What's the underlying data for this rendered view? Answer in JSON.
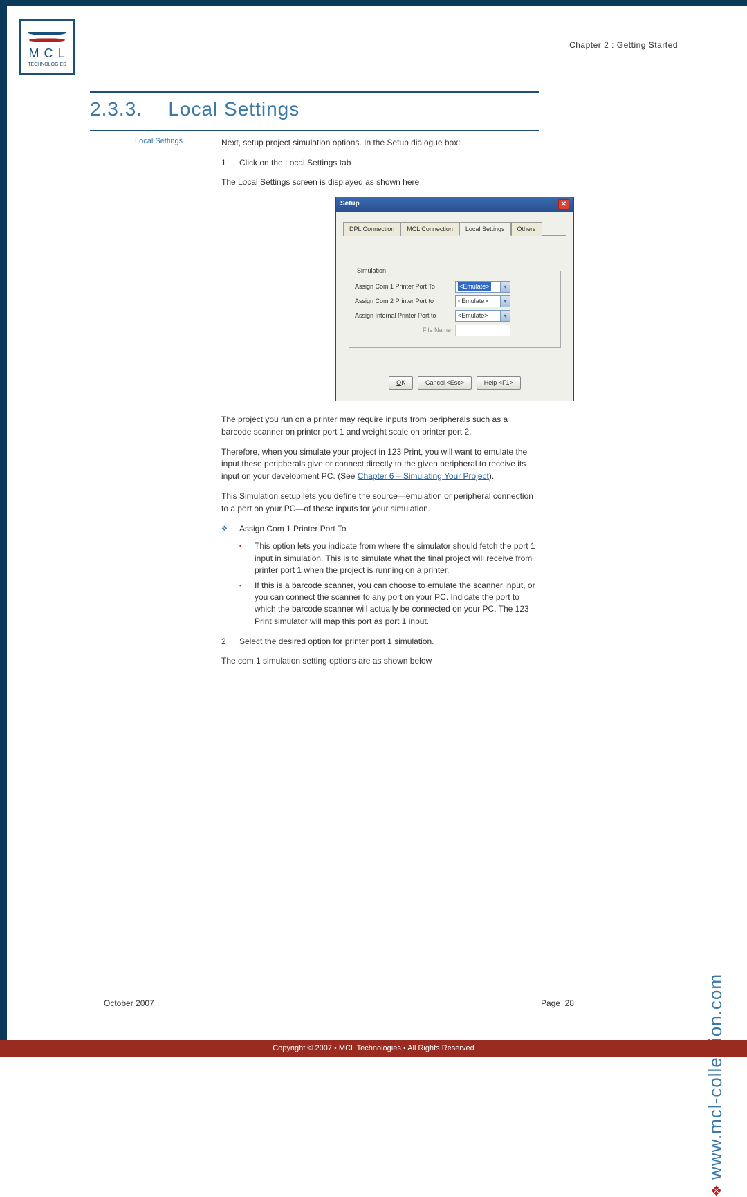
{
  "header": {
    "chapter": "Chapter 2 : Getting Started"
  },
  "logo": {
    "mcl": "M C L",
    "sub": "TECHNOLOGIES"
  },
  "section": {
    "number": "2.3.3.",
    "title": "Local Settings"
  },
  "sidelabel": "Local Settings",
  "intro1": "Next, setup project simulation options. In the Setup dialogue box:",
  "step1_num": "1",
  "step1_text": "Click on the Local Settings tab",
  "intro2": "The Local Settings screen is displayed as shown here",
  "dialog": {
    "title": "Setup",
    "tabs": {
      "dpl": "DPL Connection",
      "mcl": "MCL Connection",
      "local": "Local Settings",
      "others": "Others"
    },
    "legend": "Simulation",
    "row1_label": "Assign Com 1 Printer Port To",
    "row2_label": "Assign Com 2 Printer Port to",
    "row3_label": "Assign Internal Printer Port to",
    "filename_label": "File Name",
    "emulate": "<Emulate>",
    "ok": "OK",
    "cancel": "Cancel <Esc>",
    "help": "Help <F1>"
  },
  "para1": "The project you run on a printer may require inputs from peripherals such as a barcode scanner on printer port 1 and weight scale on printer port 2.",
  "para2a": "Therefore, when you simulate your project in 123 Print, you will want to emulate the input these peripherals give or connect directly to the given peripheral to receive its input on your development PC. (See ",
  "para2link": "Chapter 6 – Simulating Your Project",
  "para2b": ").",
  "para3": "This Simulation setup lets you define the source—emulation or peripheral connection to a port on your PC—of these inputs for your simulation.",
  "bullet_title": "Assign Com 1 Printer Port To",
  "sub1": "This option lets you indicate from where the simulator should fetch the port 1 input in simulation. This is to simulate what the final project will receive from printer port 1 when the project is running on a printer.",
  "sub2": "If this is a barcode scanner, you can choose to emulate the scanner input, or you can connect the scanner to any port on your PC. Indicate the port to which the barcode scanner will actually be connected on your PC. The 123 Print simulator will map this port as port 1 input.",
  "step2_num": "2",
  "step2_text": "Select the desired option for printer port 1 simulation.",
  "para4": "The com 1 simulation setting options are as shown below",
  "url": "www.mcl-collection.com",
  "footer": {
    "date": "October 2007",
    "page_label": "Page",
    "page_num": "28"
  },
  "copyright": "Copyright © 2007 • MCL Technologies • All Rights Reserved"
}
